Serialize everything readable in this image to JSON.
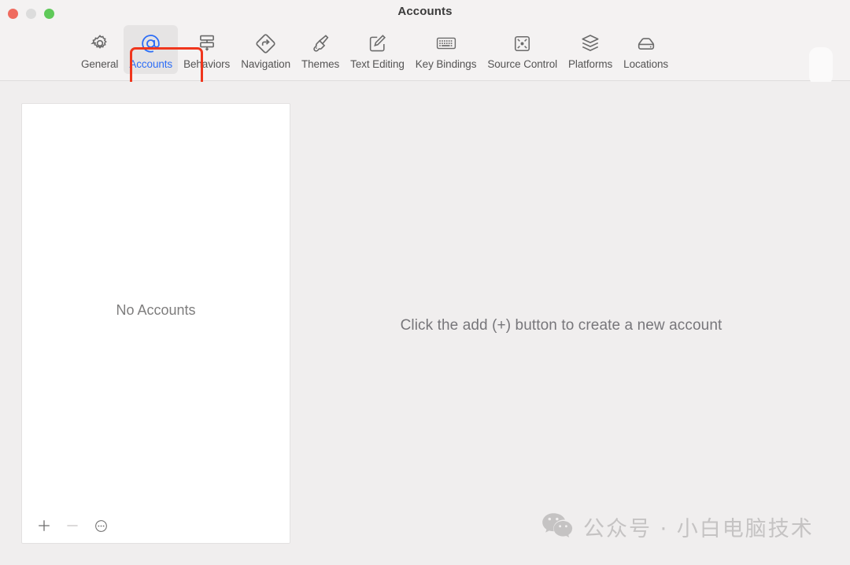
{
  "window": {
    "title": "Accounts",
    "traffic_lights": [
      {
        "name": "close",
        "color": "#ef6b5f"
      },
      {
        "name": "minimize",
        "color": "#dcdcdc"
      },
      {
        "name": "zoom",
        "color": "#5fc959"
      }
    ]
  },
  "toolbar": {
    "items": [
      {
        "icon": "gear-icon",
        "label": "General",
        "selected": false
      },
      {
        "icon": "at-sign-icon",
        "label": "Accounts",
        "selected": true
      },
      {
        "icon": "behaviors-icon",
        "label": "Behaviors",
        "selected": false
      },
      {
        "icon": "navigation-icon",
        "label": "Navigation",
        "selected": false
      },
      {
        "icon": "paintbrush-icon",
        "label": "Themes",
        "selected": false
      },
      {
        "icon": "text-editing-icon",
        "label": "Text Editing",
        "selected": false
      },
      {
        "icon": "keyboard-icon",
        "label": "Key Bindings",
        "selected": false
      },
      {
        "icon": "source-control-icon",
        "label": "Source Control",
        "selected": false
      },
      {
        "icon": "platforms-icon",
        "label": "Platforms",
        "selected": false
      },
      {
        "icon": "locations-icon",
        "label": "Locations",
        "selected": false
      }
    ],
    "selected_color": "#2d6df6",
    "annotation_color": "#f0361d"
  },
  "sidebar": {
    "empty_message": "No Accounts",
    "footer_buttons": [
      {
        "name": "add-account-button",
        "glyph": "+",
        "enabled": true
      },
      {
        "name": "remove-account-button",
        "glyph": "−",
        "enabled": false
      },
      {
        "name": "account-options-button",
        "glyph": "⋯",
        "enabled": true
      }
    ]
  },
  "detail": {
    "empty_message": "Click the add (+) button to create a new account"
  },
  "watermark": {
    "text": "公众号 · 小白电脑技术",
    "icon": "wechat-icon",
    "color": "#c5c3c3"
  }
}
